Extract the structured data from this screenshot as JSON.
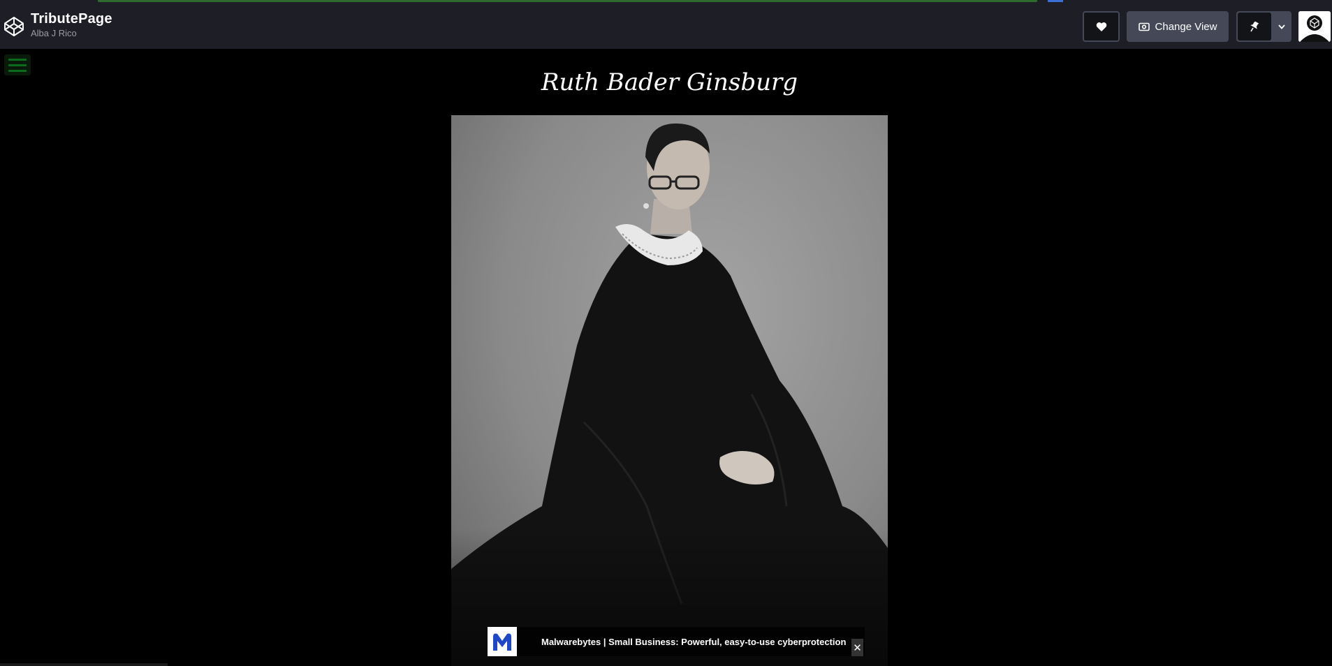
{
  "header": {
    "pen_title": "TributePage",
    "pen_author": "Alba J Rico",
    "change_view_label": "Change View"
  },
  "icons": {
    "logo": "codepen-cube-icon",
    "heart": "heart-icon",
    "change_view": "eye-box-icon",
    "pin": "pin-icon",
    "caret": "chevron-down-icon",
    "menu": "hamburger-menu-icon",
    "ad_logo": "malwarebytes-logo",
    "ad_close": "close-icon"
  },
  "content": {
    "title": "Ruth Bader Ginsburg"
  },
  "ad": {
    "text": "Malwarebytes | Small Business: Powerful, easy-to-use cyberprotection",
    "close_glyph": "✕"
  },
  "colors": {
    "header_bg": "#1e1f26",
    "page_bg": "#000000",
    "hamburger": "#0b6b1c",
    "button_bg": "#444857"
  }
}
